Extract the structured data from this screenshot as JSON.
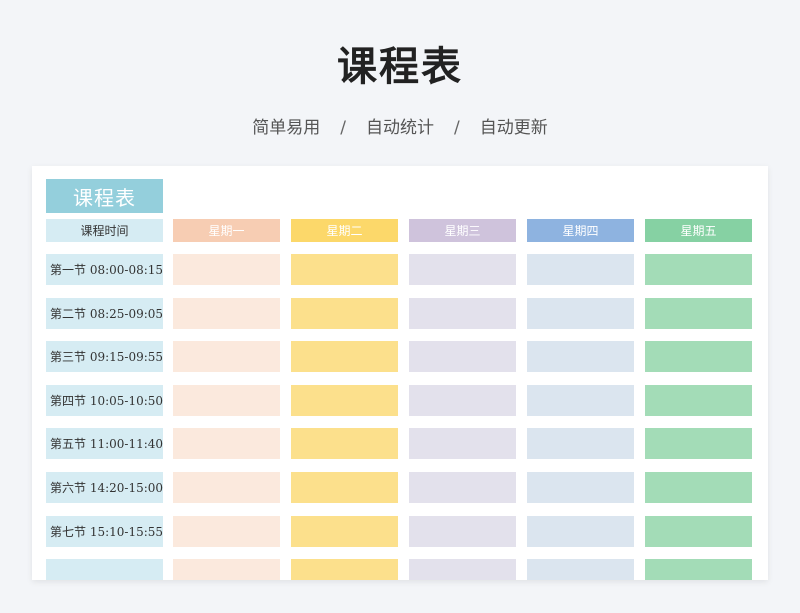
{
  "page": {
    "title": "课程表",
    "subtitle": [
      "简单易用",
      "自动统计",
      "自动更新"
    ],
    "separator": "/"
  },
  "sheet": {
    "title": "课程表",
    "time_header": "课程时间",
    "days": [
      {
        "label": "星期一",
        "header_color": "#f7cdb3",
        "cell_color": "#fbe9dd"
      },
      {
        "label": "星期二",
        "header_color": "#fcd86a",
        "cell_color": "#fce08c"
      },
      {
        "label": "星期三",
        "header_color": "#cfc3dc",
        "cell_color": "#e3e1ec"
      },
      {
        "label": "星期四",
        "header_color": "#8eb3e0",
        "cell_color": "#dbe5ef"
      },
      {
        "label": "星期五",
        "header_color": "#86d1a3",
        "cell_color": "#a3dcb7"
      }
    ],
    "periods": [
      "第一节 08:00-08:15",
      "第二节 08:25-09:05",
      "第三节 09:15-09:55",
      "第四节 10:05-10:50",
      "第五节 11:00-11:40",
      "第六节 14:20-15:00",
      "第七节 15:10-15:55"
    ]
  }
}
